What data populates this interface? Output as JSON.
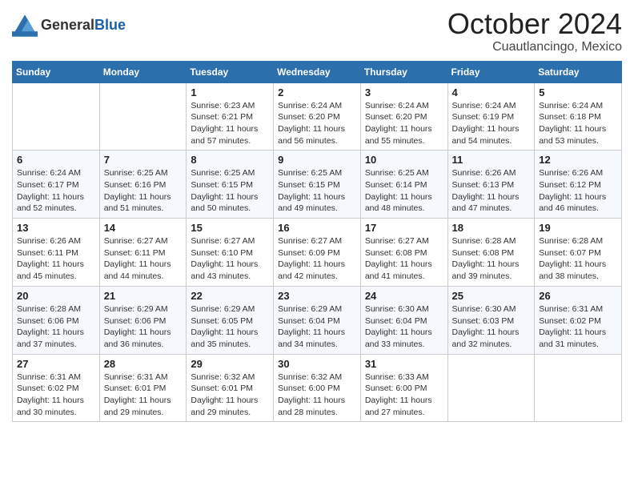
{
  "header": {
    "logo_general": "General",
    "logo_blue": "Blue",
    "month_title": "October 2024",
    "location": "Cuautlancingo, Mexico"
  },
  "days_of_week": [
    "Sunday",
    "Monday",
    "Tuesday",
    "Wednesday",
    "Thursday",
    "Friday",
    "Saturday"
  ],
  "weeks": [
    [
      {
        "day": "",
        "info": ""
      },
      {
        "day": "",
        "info": ""
      },
      {
        "day": "1",
        "info": "Sunrise: 6:23 AM\nSunset: 6:21 PM\nDaylight: 11 hours and 57 minutes."
      },
      {
        "day": "2",
        "info": "Sunrise: 6:24 AM\nSunset: 6:20 PM\nDaylight: 11 hours and 56 minutes."
      },
      {
        "day": "3",
        "info": "Sunrise: 6:24 AM\nSunset: 6:20 PM\nDaylight: 11 hours and 55 minutes."
      },
      {
        "day": "4",
        "info": "Sunrise: 6:24 AM\nSunset: 6:19 PM\nDaylight: 11 hours and 54 minutes."
      },
      {
        "day": "5",
        "info": "Sunrise: 6:24 AM\nSunset: 6:18 PM\nDaylight: 11 hours and 53 minutes."
      }
    ],
    [
      {
        "day": "6",
        "info": "Sunrise: 6:24 AM\nSunset: 6:17 PM\nDaylight: 11 hours and 52 minutes."
      },
      {
        "day": "7",
        "info": "Sunrise: 6:25 AM\nSunset: 6:16 PM\nDaylight: 11 hours and 51 minutes."
      },
      {
        "day": "8",
        "info": "Sunrise: 6:25 AM\nSunset: 6:15 PM\nDaylight: 11 hours and 50 minutes."
      },
      {
        "day": "9",
        "info": "Sunrise: 6:25 AM\nSunset: 6:15 PM\nDaylight: 11 hours and 49 minutes."
      },
      {
        "day": "10",
        "info": "Sunrise: 6:25 AM\nSunset: 6:14 PM\nDaylight: 11 hours and 48 minutes."
      },
      {
        "day": "11",
        "info": "Sunrise: 6:26 AM\nSunset: 6:13 PM\nDaylight: 11 hours and 47 minutes."
      },
      {
        "day": "12",
        "info": "Sunrise: 6:26 AM\nSunset: 6:12 PM\nDaylight: 11 hours and 46 minutes."
      }
    ],
    [
      {
        "day": "13",
        "info": "Sunrise: 6:26 AM\nSunset: 6:11 PM\nDaylight: 11 hours and 45 minutes."
      },
      {
        "day": "14",
        "info": "Sunrise: 6:27 AM\nSunset: 6:11 PM\nDaylight: 11 hours and 44 minutes."
      },
      {
        "day": "15",
        "info": "Sunrise: 6:27 AM\nSunset: 6:10 PM\nDaylight: 11 hours and 43 minutes."
      },
      {
        "day": "16",
        "info": "Sunrise: 6:27 AM\nSunset: 6:09 PM\nDaylight: 11 hours and 42 minutes."
      },
      {
        "day": "17",
        "info": "Sunrise: 6:27 AM\nSunset: 6:08 PM\nDaylight: 11 hours and 41 minutes."
      },
      {
        "day": "18",
        "info": "Sunrise: 6:28 AM\nSunset: 6:08 PM\nDaylight: 11 hours and 39 minutes."
      },
      {
        "day": "19",
        "info": "Sunrise: 6:28 AM\nSunset: 6:07 PM\nDaylight: 11 hours and 38 minutes."
      }
    ],
    [
      {
        "day": "20",
        "info": "Sunrise: 6:28 AM\nSunset: 6:06 PM\nDaylight: 11 hours and 37 minutes."
      },
      {
        "day": "21",
        "info": "Sunrise: 6:29 AM\nSunset: 6:06 PM\nDaylight: 11 hours and 36 minutes."
      },
      {
        "day": "22",
        "info": "Sunrise: 6:29 AM\nSunset: 6:05 PM\nDaylight: 11 hours and 35 minutes."
      },
      {
        "day": "23",
        "info": "Sunrise: 6:29 AM\nSunset: 6:04 PM\nDaylight: 11 hours and 34 minutes."
      },
      {
        "day": "24",
        "info": "Sunrise: 6:30 AM\nSunset: 6:04 PM\nDaylight: 11 hours and 33 minutes."
      },
      {
        "day": "25",
        "info": "Sunrise: 6:30 AM\nSunset: 6:03 PM\nDaylight: 11 hours and 32 minutes."
      },
      {
        "day": "26",
        "info": "Sunrise: 6:31 AM\nSunset: 6:02 PM\nDaylight: 11 hours and 31 minutes."
      }
    ],
    [
      {
        "day": "27",
        "info": "Sunrise: 6:31 AM\nSunset: 6:02 PM\nDaylight: 11 hours and 30 minutes."
      },
      {
        "day": "28",
        "info": "Sunrise: 6:31 AM\nSunset: 6:01 PM\nDaylight: 11 hours and 29 minutes."
      },
      {
        "day": "29",
        "info": "Sunrise: 6:32 AM\nSunset: 6:01 PM\nDaylight: 11 hours and 29 minutes."
      },
      {
        "day": "30",
        "info": "Sunrise: 6:32 AM\nSunset: 6:00 PM\nDaylight: 11 hours and 28 minutes."
      },
      {
        "day": "31",
        "info": "Sunrise: 6:33 AM\nSunset: 6:00 PM\nDaylight: 11 hours and 27 minutes."
      },
      {
        "day": "",
        "info": ""
      },
      {
        "day": "",
        "info": ""
      }
    ]
  ]
}
